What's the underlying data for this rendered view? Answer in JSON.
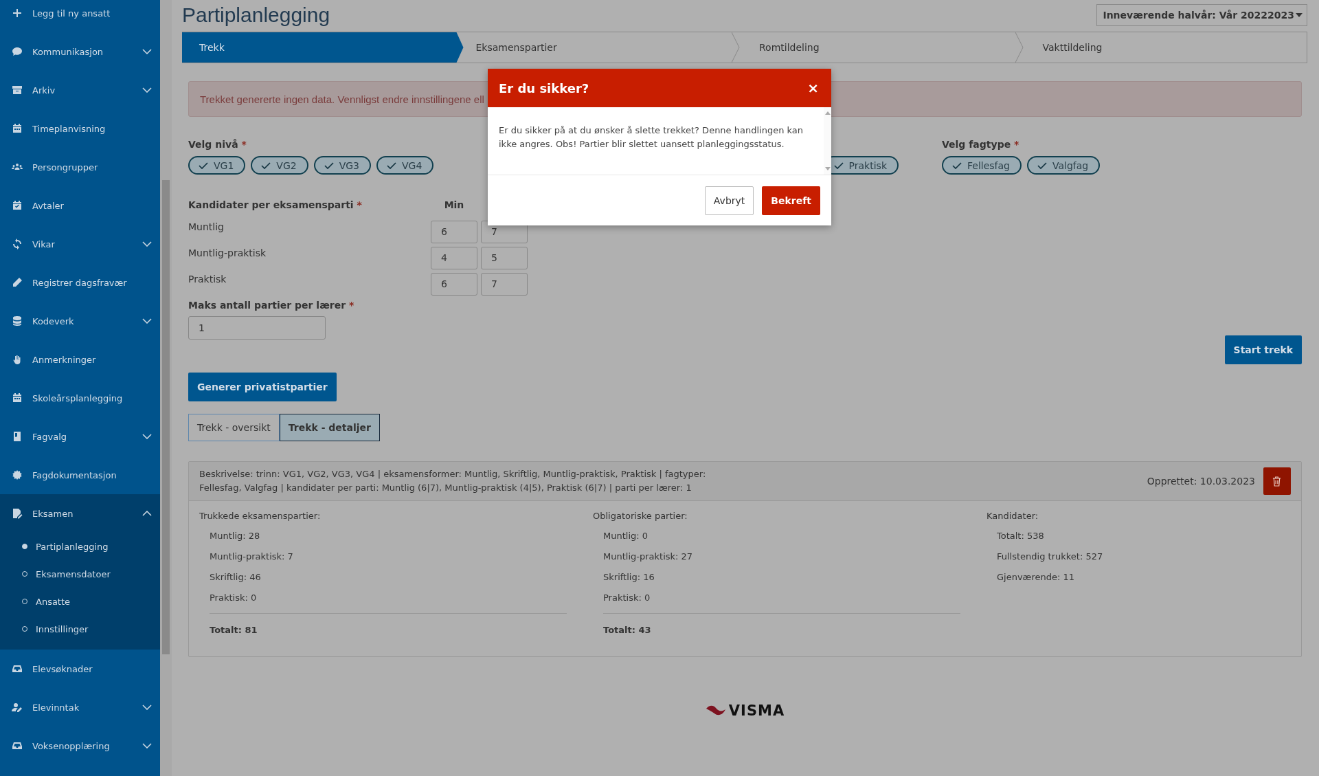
{
  "sidebar": {
    "items": [
      {
        "label": "Legg til ny ansatt",
        "kind": "link"
      },
      {
        "label": "Kommunikasjon",
        "kind": "group",
        "expanded": false
      },
      {
        "label": "Arkiv",
        "kind": "group",
        "expanded": false
      },
      {
        "label": "Timeplanvisning",
        "kind": "link"
      },
      {
        "label": "Persongrupper",
        "kind": "link"
      },
      {
        "label": "Avtaler",
        "kind": "link"
      },
      {
        "label": "Vikar",
        "kind": "group",
        "expanded": false
      },
      {
        "label": "Registrer dagsfravær",
        "kind": "link"
      },
      {
        "label": "Kodeverk",
        "kind": "group",
        "expanded": false
      },
      {
        "label": "Anmerkninger",
        "kind": "link"
      },
      {
        "label": "Skoleårsplanlegging",
        "kind": "link"
      },
      {
        "label": "Fagvalg",
        "kind": "group",
        "expanded": false
      },
      {
        "label": "Fagdokumentasjon",
        "kind": "link"
      },
      {
        "label": "Eksamen",
        "kind": "group",
        "expanded": true,
        "children": [
          {
            "label": "Partiplanlegging",
            "selected": true
          },
          {
            "label": "Eksamensdatoer",
            "selected": false
          },
          {
            "label": "Ansatte",
            "selected": false
          },
          {
            "label": "Innstillinger",
            "selected": false
          }
        ]
      },
      {
        "label": "Elevsøknader",
        "kind": "link"
      },
      {
        "label": "Elevinntak",
        "kind": "group",
        "expanded": false
      },
      {
        "label": "Voksenopplæring",
        "kind": "group",
        "expanded": false
      }
    ]
  },
  "page": {
    "title": "Partiplanlegging",
    "term_select": "Inneværende halvår: Vår 20222023"
  },
  "steps": [
    {
      "label": "Trekk",
      "selected": true
    },
    {
      "label": "Eksamenspartier",
      "selected": false
    },
    {
      "label": "Romtildeling",
      "selected": false
    },
    {
      "label": "Vakttildeling",
      "selected": false
    }
  ],
  "alert": "Trekket genererte ingen data. Vennligst endre innstillingene ell",
  "filters": [
    {
      "label": "Velg nivå",
      "required": "*",
      "chips": [
        {
          "label": "VG1",
          "checked": true
        },
        {
          "label": "VG2",
          "checked": true
        },
        {
          "label": "VG3",
          "checked": true
        },
        {
          "label": "VG4",
          "checked": true
        }
      ]
    },
    {
      "chips": [
        {
          "label": "Praktisk",
          "checked": true
        }
      ]
    },
    {
      "label": "Velg fagtype",
      "required": "*",
      "chips": [
        {
          "label": "Fellesfag",
          "checked": true
        },
        {
          "label": "Valgfag",
          "checked": true
        }
      ]
    }
  ],
  "candidates": {
    "label": "Kandidater per eksamensparti",
    "required": "*",
    "min_header": "Min",
    "rows": [
      {
        "label": "Muntlig",
        "min": "6",
        "max": "7"
      },
      {
        "label": "Muntlig-praktisk",
        "min": "4",
        "max": "5"
      },
      {
        "label": "Praktisk",
        "min": "6",
        "max": "7"
      }
    ]
  },
  "max_per_teacher": {
    "label": "Maks antall partier per lærer",
    "required": "*",
    "value": "1"
  },
  "start_button": "Start trekk",
  "generate_button": "Generer privatistpartier",
  "tabs": [
    {
      "label": "Trekk - oversikt",
      "selected": false
    },
    {
      "label": "Trekk - detaljer",
      "selected": true
    }
  ],
  "details": {
    "description": "Beskrivelse: trinn: VG1, VG2, VG3, VG4 | eksamensformer: Muntlig, Skriftlig, Muntlig-praktisk, Praktisk | fagtyper: Fellesfag, Valgfag | kandidater per parti: Muntlig (6|7), Muntlig-praktisk (4|5), Praktisk (6|7) | parti per lærer: 1",
    "created": "Opprettet: 10.03.2023",
    "columns": [
      {
        "title": "Trukkede eksamenspartier:",
        "items": [
          "Muntlig: 28",
          "Muntlig-praktisk: 7",
          "Skriftlig: 46",
          "Praktisk: 0"
        ],
        "total": "Totalt: 81"
      },
      {
        "title": "Obligatoriske partier:",
        "items": [
          "Muntlig: 0",
          "Muntlig-praktisk: 27",
          "Skriftlig: 16",
          "Praktisk: 0"
        ],
        "total": "Totalt: 43"
      },
      {
        "title": "Kandidater:",
        "items": [
          "Totalt: 538",
          "Fullstendig trukket: 527",
          "Gjenværende: 11"
        ]
      }
    ]
  },
  "footer_logo": "VISMA",
  "dialog": {
    "title": "Er du sikker?",
    "close": "×",
    "message": "Er du sikker på at du ønsker å slette trekket? Denne handlingen kan ikke angres. Obs! Partier blir slettet uansett planleggingsstatus.",
    "buttons": [
      {
        "label": "Avbryt",
        "kind": "secondary"
      },
      {
        "label": "Bekreft",
        "kind": "primary"
      }
    ]
  }
}
